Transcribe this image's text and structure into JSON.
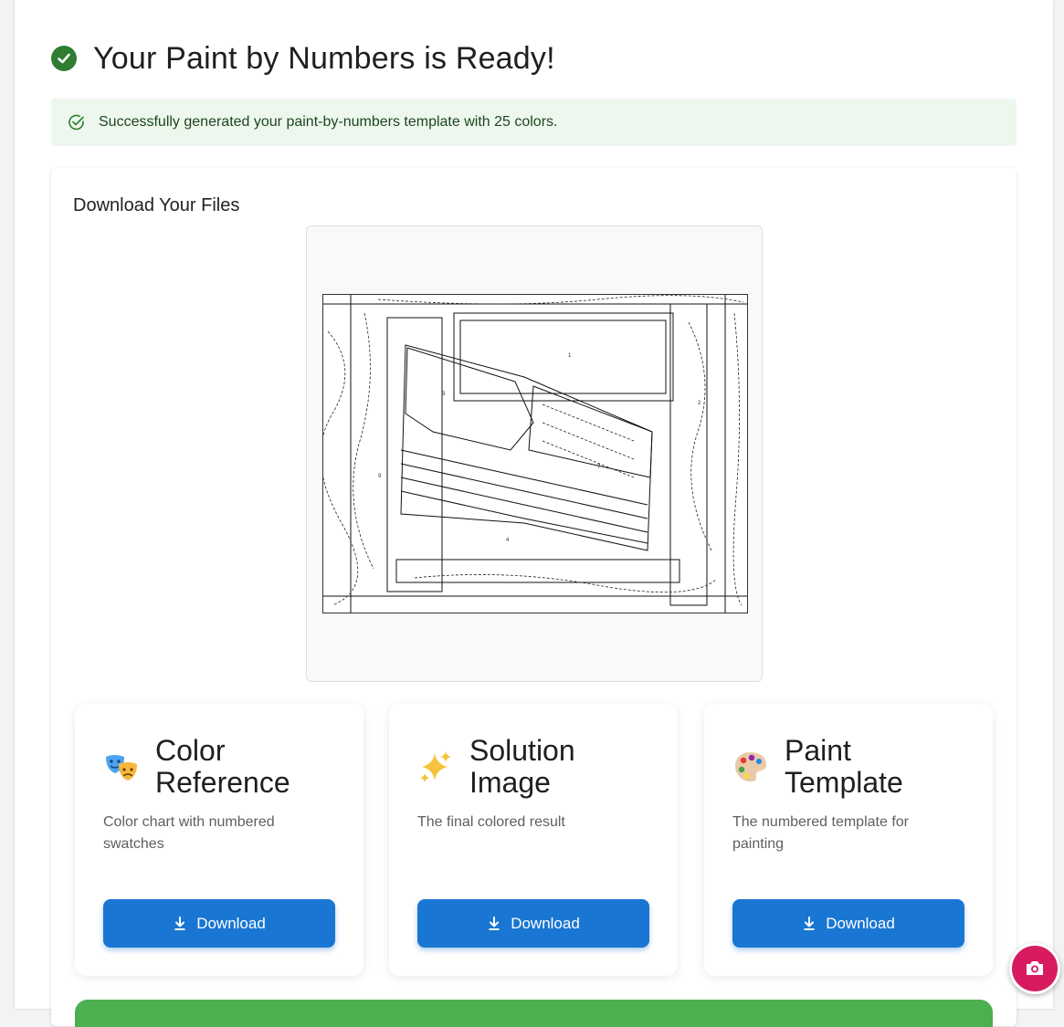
{
  "header": {
    "title": "Your Paint by Numbers is Ready!"
  },
  "alert": {
    "message": "Successfully generated your paint-by-numbers template with 25 colors."
  },
  "downloads": {
    "section_title": "Download Your Files",
    "items": [
      {
        "title": "Color Reference",
        "description": "Color chart with numbered swatches",
        "button_label": "Download",
        "emoji": "theater-masks-icon"
      },
      {
        "title": "Solution Image",
        "description": "The final colored result",
        "button_label": "Download",
        "emoji": "sparkles-icon"
      },
      {
        "title": "Paint Template",
        "description": "The numbered template for painting",
        "button_label": "Download",
        "emoji": "artist-palette-icon"
      }
    ]
  },
  "colors": {
    "success": "#2e7d32",
    "alert_bg": "#edf7ed",
    "primary": "#1976d2",
    "green_bar": "#4caf50",
    "fab": "#d81b60"
  }
}
